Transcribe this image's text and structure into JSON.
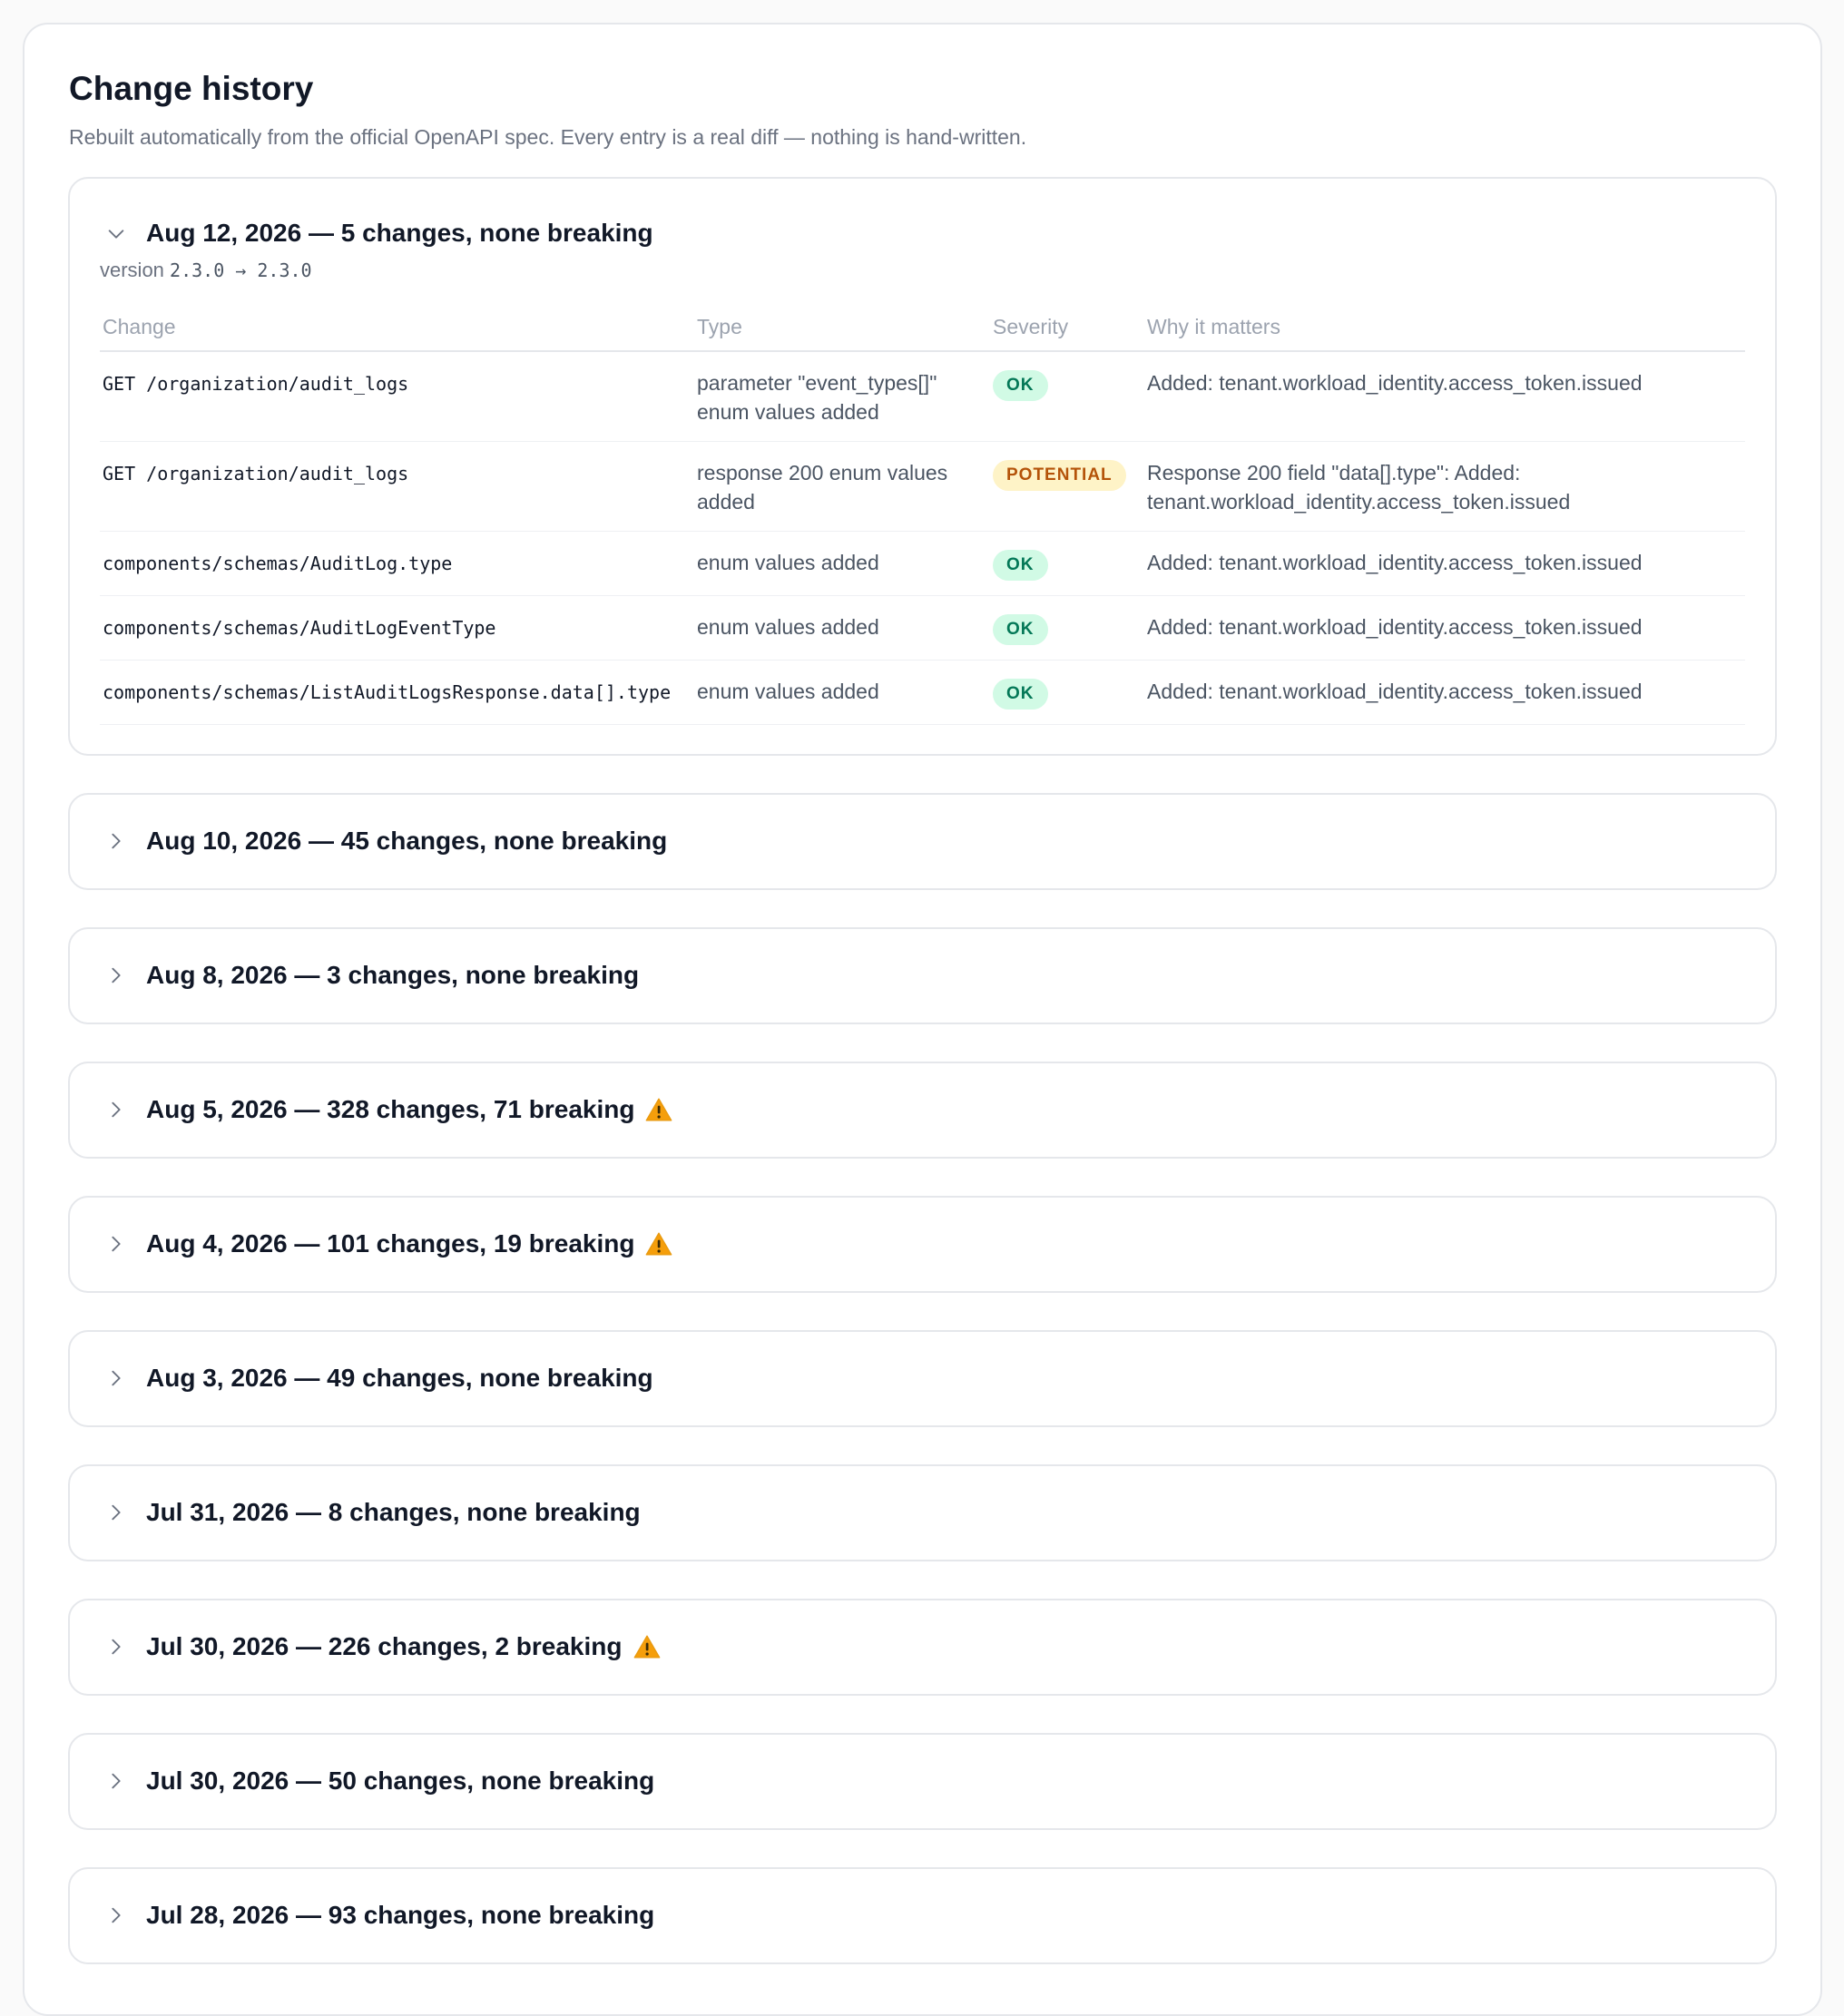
{
  "header": {
    "title": "Change history",
    "subtitle": "Rebuilt automatically from the official OpenAPI spec. Every entry is a real diff — nothing is hand-written."
  },
  "expanded_entry": {
    "title": "Aug 12, 2026 — 5 changes, none breaking",
    "version_prefix": "version",
    "version_from_to": "2.3.0 → 2.3.0",
    "columns": [
      "Change",
      "Type",
      "Severity",
      "Why it matters"
    ],
    "rows": [
      {
        "change": "GET /organization/audit_logs",
        "type": "parameter \"event_types[]\" enum values added",
        "severity": "OK",
        "why": "Added: tenant.workload_identity.access_token.issued"
      },
      {
        "change": "GET /organization/audit_logs",
        "type": "response 200 enum values added",
        "severity": "POTENTIAL",
        "why": "Response 200 field \"data[].type\": Added: tenant.workload_identity.access_token.issued"
      },
      {
        "change": "components/schemas/AuditLog.type",
        "type": "enum values added",
        "severity": "OK",
        "why": "Added: tenant.workload_identity.access_token.issued"
      },
      {
        "change": "components/schemas/AuditLogEventType",
        "type": "enum values added",
        "severity": "OK",
        "why": "Added: tenant.workload_identity.access_token.issued"
      },
      {
        "change": "components/schemas/ListAuditLogsResponse.data[].type",
        "type": "enum values added",
        "severity": "OK",
        "why": "Added: tenant.workload_identity.access_token.issued"
      }
    ]
  },
  "collapsed_entries": [
    {
      "title": "Aug 10, 2026 — 45 changes, none breaking",
      "breaking": false
    },
    {
      "title": "Aug 8, 2026 — 3 changes, none breaking",
      "breaking": false
    },
    {
      "title": "Aug 5, 2026 — 328 changes, 71 breaking",
      "breaking": true
    },
    {
      "title": "Aug 4, 2026 — 101 changes, 19 breaking",
      "breaking": true
    },
    {
      "title": "Aug 3, 2026 — 49 changes, none breaking",
      "breaking": false
    },
    {
      "title": "Jul 31, 2026 — 8 changes, none breaking",
      "breaking": false
    },
    {
      "title": "Jul 30, 2026 — 226 changes, 2 breaking",
      "breaking": true
    },
    {
      "title": "Jul 30, 2026 — 50 changes, none breaking",
      "breaking": false
    },
    {
      "title": "Jul 28, 2026 — 93 changes, none breaking",
      "breaking": false
    }
  ],
  "icons": {
    "expanded": "chevron-down-icon",
    "collapsed": "chevron-right-icon",
    "breaking": "warning-icon"
  },
  "colors": {
    "ok_bg": "#d1fae5",
    "ok_text": "#047857",
    "potential_bg": "#fef3c7",
    "potential_text": "#b45309",
    "warning": "#f59e0b"
  }
}
